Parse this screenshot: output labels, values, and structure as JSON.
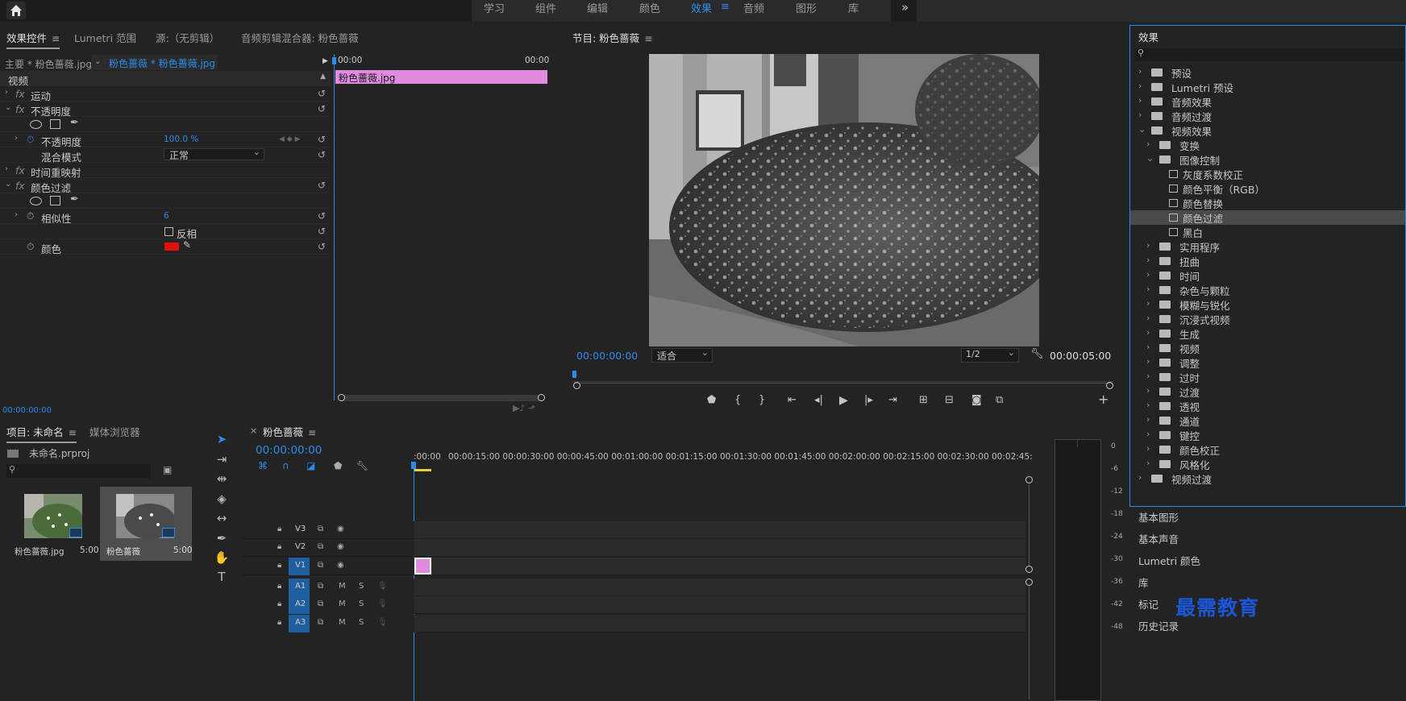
{
  "workspace_tabs": [
    "学习",
    "组件",
    "编辑",
    "颜色",
    "效果",
    "音频",
    "图形",
    "库"
  ],
  "workspace_active": "效果",
  "more_icon": "»",
  "effect_controls": {
    "tabs": [
      "效果控件",
      "Lumetri 范围",
      "源:（无剪辑）",
      "音频剪辑混合器: 粉色蔷薇"
    ],
    "master_label": "主要 * 粉色蔷薇.jpg",
    "clip_label": "粉色蔷薇 * 粉色蔷薇.jpg",
    "section_video": "视频",
    "motion": "运动",
    "opacity_group": "不透明度",
    "opacity_label": "不透明度",
    "opacity_value": "100.0 %",
    "blend_label": "混合模式",
    "blend_value": "正常",
    "time_remap": "时间重映射",
    "color_pass": "颜色过滤",
    "similarity_label": "相似性",
    "similarity_value": "6",
    "invert_label": "反相",
    "color_label": "颜色",
    "timecode": "00:00:00:00",
    "mini_ruler_start": "00:00",
    "mini_ruler_end": "00:00",
    "clip_name": "粉色蔷薇.jpg",
    "fx_symbol": "fx",
    "swatch_color": "#e01010"
  },
  "program": {
    "title": "节目: 粉色蔷薇",
    "timecode": "00:00:00:00",
    "fit": "适合",
    "res": "1/2",
    "duration": "00:00:05:00"
  },
  "effects_panel": {
    "title": "效果",
    "items": [
      {
        "label": "预设",
        "indent": 0,
        "type": "folder-star",
        "open": false
      },
      {
        "label": "Lumetri 预设",
        "indent": 0,
        "type": "folder-star",
        "open": false
      },
      {
        "label": "音频效果",
        "indent": 0,
        "type": "folder",
        "open": false
      },
      {
        "label": "音频过渡",
        "indent": 0,
        "type": "folder",
        "open": false
      },
      {
        "label": "视频效果",
        "indent": 0,
        "type": "folder",
        "open": true
      },
      {
        "label": "变换",
        "indent": 1,
        "type": "folder",
        "open": false
      },
      {
        "label": "图像控制",
        "indent": 1,
        "type": "folder",
        "open": true
      },
      {
        "label": "灰度系数校正",
        "indent": 2,
        "type": "fx"
      },
      {
        "label": "颜色平衡（RGB）",
        "indent": 2,
        "type": "fx"
      },
      {
        "label": "颜色替换",
        "indent": 2,
        "type": "fx"
      },
      {
        "label": "颜色过滤",
        "indent": 2,
        "type": "fx",
        "selected": true
      },
      {
        "label": "黑白",
        "indent": 2,
        "type": "fx"
      },
      {
        "label": "实用程序",
        "indent": 1,
        "type": "folder",
        "open": false
      },
      {
        "label": "扭曲",
        "indent": 1,
        "type": "folder",
        "open": false
      },
      {
        "label": "时间",
        "indent": 1,
        "type": "folder",
        "open": false
      },
      {
        "label": "杂色与颗粒",
        "indent": 1,
        "type": "folder",
        "open": false
      },
      {
        "label": "模糊与锐化",
        "indent": 1,
        "type": "folder",
        "open": false
      },
      {
        "label": "沉浸式视频",
        "indent": 1,
        "type": "folder",
        "open": false
      },
      {
        "label": "生成",
        "indent": 1,
        "type": "folder",
        "open": false
      },
      {
        "label": "视频",
        "indent": 1,
        "type": "folder",
        "open": false
      },
      {
        "label": "调整",
        "indent": 1,
        "type": "folder",
        "open": false
      },
      {
        "label": "过时",
        "indent": 1,
        "type": "folder",
        "open": false
      },
      {
        "label": "过渡",
        "indent": 1,
        "type": "folder",
        "open": false
      },
      {
        "label": "透视",
        "indent": 1,
        "type": "folder",
        "open": false
      },
      {
        "label": "通道",
        "indent": 1,
        "type": "folder",
        "open": false
      },
      {
        "label": "键控",
        "indent": 1,
        "type": "folder",
        "open": false
      },
      {
        "label": "颜色校正",
        "indent": 1,
        "type": "folder",
        "open": false
      },
      {
        "label": "风格化",
        "indent": 1,
        "type": "folder",
        "open": false
      },
      {
        "label": "视频过渡",
        "indent": 0,
        "type": "folder",
        "open": false
      }
    ],
    "side_panels": [
      "基本图形",
      "基本声音",
      "Lumetri 颜色",
      "库",
      "标记",
      "历史记录"
    ]
  },
  "project": {
    "tabs": [
      "项目: 未命名",
      "媒体浏览器"
    ],
    "file": "未命名.prproj",
    "items": [
      {
        "name": "粉色蔷薇.jpg",
        "duration": "5:00"
      },
      {
        "name": "粉色蔷薇",
        "duration": "5:00"
      }
    ]
  },
  "timeline": {
    "title": "粉色蔷薇",
    "close": "×",
    "timecode": "00:00:00:00",
    "ticks": [
      ":00:00",
      "00:00:15:00",
      "00:00:30:00",
      "00:00:45:00",
      "00:01:00:00",
      "00:01:15:00",
      "00:01:30:00",
      "00:01:45:00",
      "00:02:00:00",
      "00:02:15:00",
      "00:02:30:00",
      "00:02:45:"
    ],
    "video_tracks": [
      "V3",
      "V2",
      "V1"
    ],
    "audio_tracks": [
      "A1",
      "A2",
      "A3"
    ],
    "mute": "M",
    "solo": "S"
  },
  "meter": {
    "labels": [
      "0",
      "-6",
      "-12",
      "-18",
      "-24",
      "-30",
      "-36",
      "-42",
      "-48"
    ]
  },
  "watermark": "最需教育"
}
